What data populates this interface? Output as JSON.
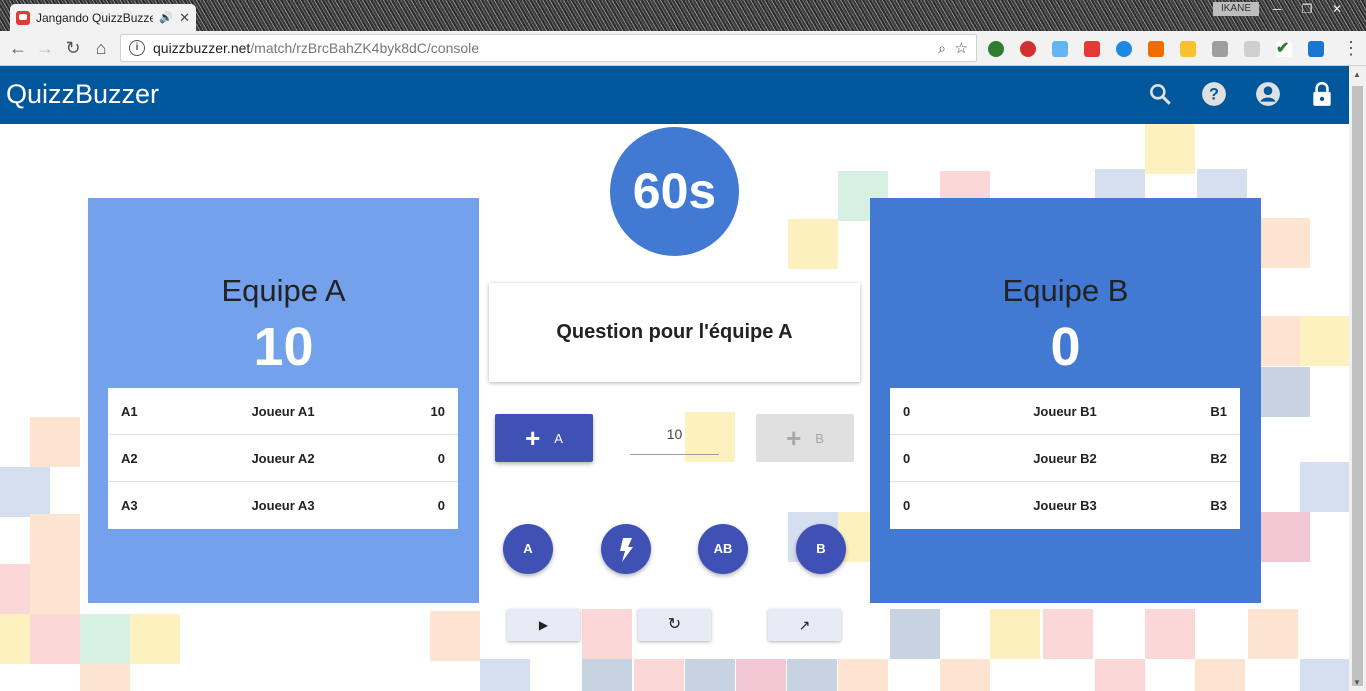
{
  "browser": {
    "tab_title": "Jangando QuizzBuzzer",
    "tab_audio": "🔊",
    "tab_close": "✕",
    "user_badge": "IKANE",
    "url_host": "quizzbuzzer.net",
    "url_path": "/match/rzBrcBahZK4byk8dC/console"
  },
  "app": {
    "brand": "QuizzBuzzer",
    "colors": {
      "appbar": "#01579b",
      "team_a": "#74a1ec",
      "team_b": "#4279d3",
      "accent": "#3f51b5"
    }
  },
  "timer": {
    "label": "60s"
  },
  "question": {
    "text": "Question pour l'équipe A"
  },
  "team_a": {
    "name": "Equipe A",
    "score": "10",
    "players": [
      {
        "code": "A1",
        "name": "Joueur A1",
        "points": "10"
      },
      {
        "code": "A2",
        "name": "Joueur A2",
        "points": "0"
      },
      {
        "code": "A3",
        "name": "Joueur A3",
        "points": "0"
      }
    ]
  },
  "team_b": {
    "name": "Equipe B",
    "score": "0",
    "players": [
      {
        "points": "0",
        "name": "Joueur B1",
        "code": "B1"
      },
      {
        "points": "0",
        "name": "Joueur B2",
        "code": "B2"
      },
      {
        "points": "0",
        "name": "Joueur B3",
        "code": "B3"
      }
    ]
  },
  "controls": {
    "add_a_plus": "+",
    "add_a_label": "A",
    "add_b_plus": "+",
    "add_b_label": "B",
    "points_value": "10",
    "buzz_a": "A",
    "buzz_flash_icon": "flash-icon",
    "buzz_ab": "AB",
    "buzz_b": "B",
    "play_icon": "▶",
    "reset_icon": "↻",
    "open_icon": "↗"
  }
}
